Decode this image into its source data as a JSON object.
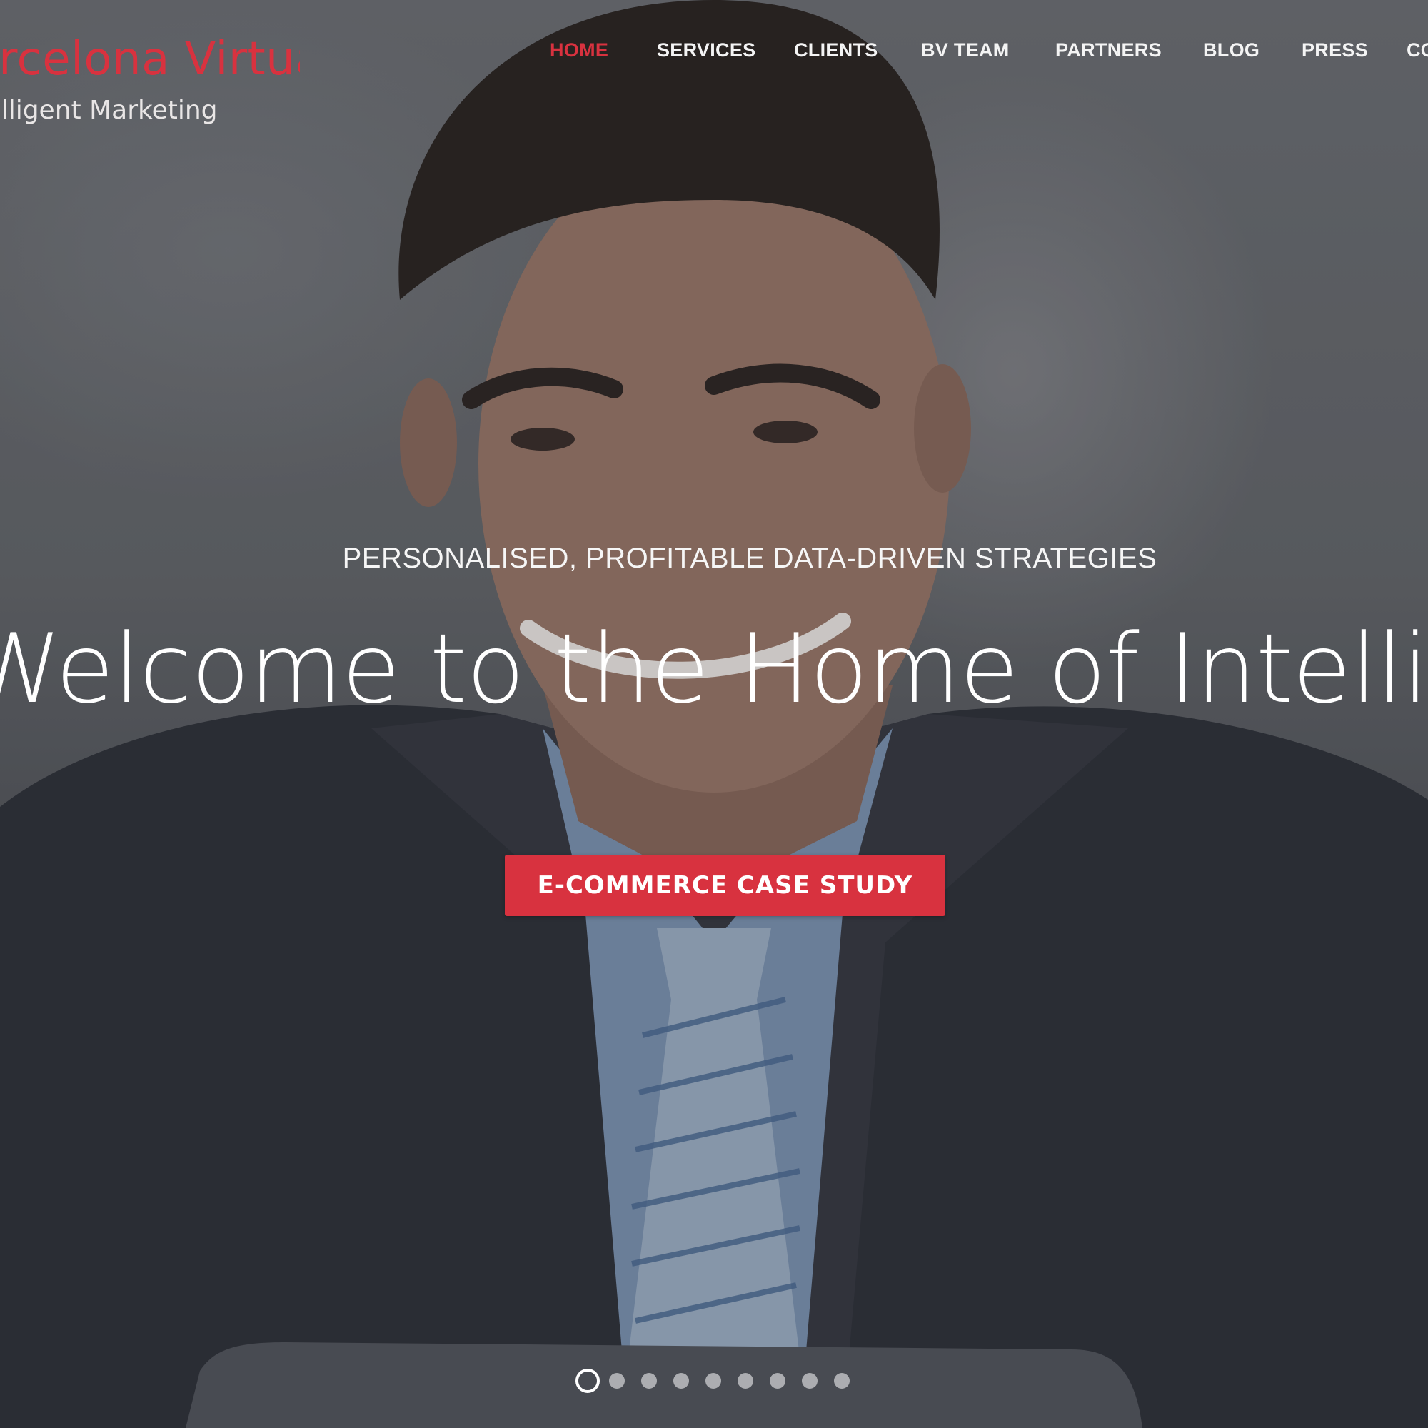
{
  "brand": {
    "name": "Barcelona Virtual",
    "tagline": "Intelligent Marketing",
    "accent_color": "#d8323f"
  },
  "nav": {
    "items": [
      {
        "label": "HOME",
        "active": true
      },
      {
        "label": "SERVICES",
        "active": false
      },
      {
        "label": "CLIENTS",
        "active": false
      },
      {
        "label": "BV TEAM",
        "active": false
      },
      {
        "label": "PARTNERS",
        "active": false
      },
      {
        "label": "BLOG",
        "active": false
      },
      {
        "label": "PRESS",
        "active": false
      },
      {
        "label": "CONTACT",
        "active": false
      }
    ]
  },
  "hero": {
    "subtitle": "PERSONALISED, PROFITABLE DATA-DRIVEN STRATEGIES",
    "headline": "Welcome to the Home of Intelligent Marketing",
    "cta_label": "E-COMMERCE CASE STUDY",
    "background_subject": "smiling businessman in suit and striped tie"
  },
  "slider": {
    "total_slides": 9,
    "active_index": 0
  }
}
